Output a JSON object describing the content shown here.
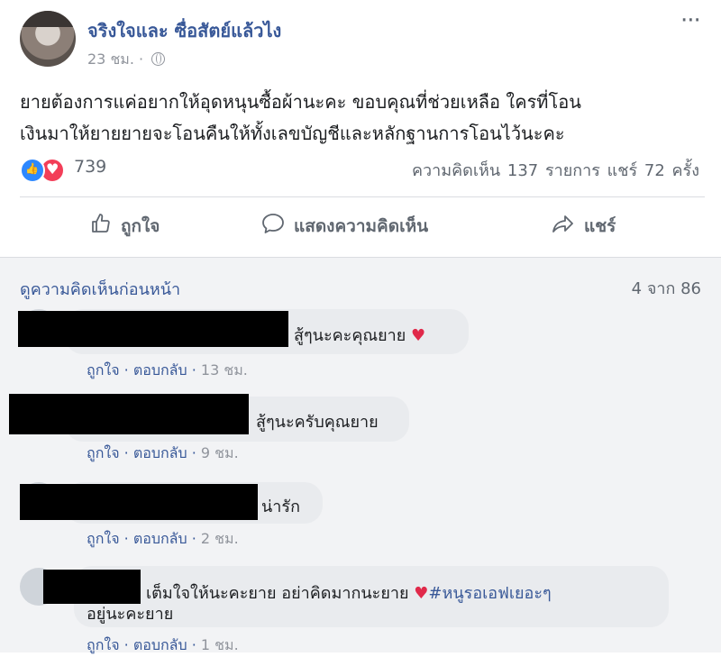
{
  "post": {
    "author": "จริงใจและ ซื่อสัตย์แล้วไง",
    "time": "23 ชม. ·",
    "text_line1": "ยายต้องการแค่อยากให้อุดหนุนซื้อผ้านะคะ ขอบคุณที่ช่วยเหลือ ใครที่โอน",
    "text_line2": "เงินมาให้ยายยายจะโอนคืนให้ทั้งเลขบัญชีและหลักฐานการโอนไว้นะคะ",
    "more": "···"
  },
  "reactions": {
    "count": "739",
    "stats": "ความคิดเห็น 137 รายการ  แชร์ 72 ครั้ง"
  },
  "actions": {
    "like": "ถูกใจ",
    "comment": "แสดงความคิดเห็น",
    "share": "แชร์"
  },
  "comments_header": {
    "previous": "ดูความคิดเห็นก่อนหน้า",
    "count": "4 จาก 86"
  },
  "comments": [
    {
      "text": "สู้ๆนะคะคุณยาย",
      "like": "ถูกใจ",
      "reply": "ตอบกลับ",
      "time": "13 ชม."
    },
    {
      "text": "สู้ๆนะครับคุณยาย",
      "like": "ถูกใจ",
      "reply": "ตอบกลับ",
      "time": "9 ชม."
    },
    {
      "text": "น่ารัก",
      "like": "ถูกใจ",
      "reply": "ตอบกลับ",
      "time": "2 ชม."
    },
    {
      "text_line1": "เต็มใจให้นะคะยาย อย่าคิดมากนะยาย",
      "hashtag": "#หนูรอเอฟเยอะๆ",
      "text_line2": "อยู่นะคะยาย",
      "like": "ถูกใจ",
      "reply": "ตอบกลับ",
      "time": "1 ชม."
    }
  ],
  "colors": {
    "link": "#385898",
    "like_reaction": "#2d88ff",
    "love_reaction": "#f33e58"
  }
}
